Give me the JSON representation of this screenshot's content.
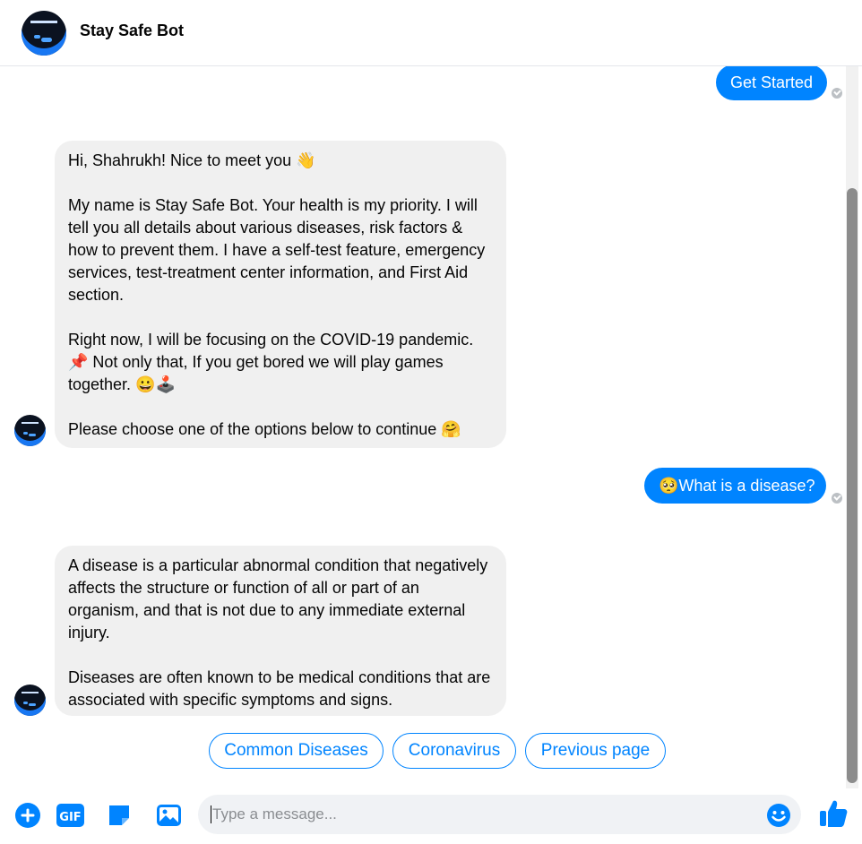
{
  "header": {
    "bot_name": "Stay Safe Bot",
    "avatar_icon": "bot-logo"
  },
  "messages": {
    "user1": "Get Started",
    "bot1": "Hi, Shahrukh! Nice to meet you 👋\n\nMy name is Stay Safe Bot. Your health is my priority. I will tell you all details about various diseases, risk factors & how to prevent them. I have a self-test feature, emergency services, test-treatment center information, and First Aid section.\n\nRight now, I will be focusing on the COVID-19 pandemic. 📌 Not only that, If you get bored we will play games together. 😀🕹️\n\nPlease choose one of the options below to continue 🤗",
    "user2": "🥺What is a disease?",
    "bot2": "A disease is a particular abnormal condition that negatively affects the structure or function of all or part of an organism, and that is not due to any immediate external injury.\n\nDiseases are often known to be medical conditions that are associated with specific symptoms and signs."
  },
  "quick_replies": [
    "Common Diseases",
    "Coronavirus",
    "Previous page"
  ],
  "composer": {
    "placeholder": "Type a message...",
    "icons": [
      "plus-icon",
      "gif-icon",
      "sticker-icon",
      "image-icon",
      "emoji-icon",
      "like-icon"
    ]
  },
  "colors": {
    "accent": "#0084ff",
    "bot_bubble": "#f0f0f0",
    "composer_bg": "#f0f2f5"
  }
}
